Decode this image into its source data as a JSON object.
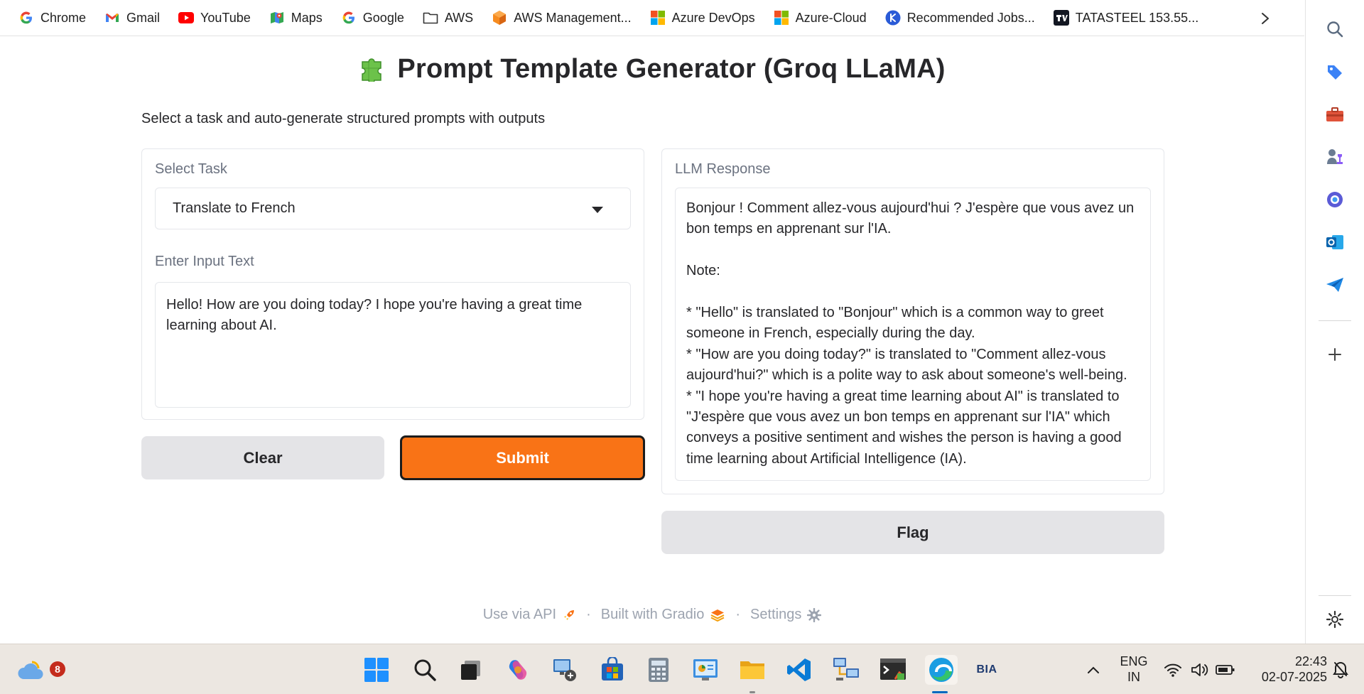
{
  "bookmarks": [
    {
      "label": "Chrome",
      "icon": "google-g-icon"
    },
    {
      "label": "Gmail",
      "icon": "gmail-icon"
    },
    {
      "label": "YouTube",
      "icon": "youtube-icon"
    },
    {
      "label": "Maps",
      "icon": "maps-icon"
    },
    {
      "label": "Google",
      "icon": "google-g-icon"
    },
    {
      "label": "AWS",
      "icon": "folder-icon"
    },
    {
      "label": "AWS Management...",
      "icon": "aws-cube-icon"
    },
    {
      "label": "Azure DevOps",
      "icon": "microsoft-logo-icon"
    },
    {
      "label": "Azure-Cloud",
      "icon": "microsoft-logo-icon"
    },
    {
      "label": "Recommended Jobs...",
      "icon": "naukri-icon"
    },
    {
      "label": "TATASTEEL 153.55...",
      "icon": "tradingview-icon"
    }
  ],
  "app": {
    "title": "Prompt Template Generator (Groq LLaMA)",
    "description": "Select a task and auto-generate structured prompts with outputs",
    "task_label": "Select Task",
    "task_value": "Translate to French",
    "input_label": "Enter Input Text",
    "input_value": "Hello! How are you doing today? I hope you're having a great time learning about AI.",
    "clear_label": "Clear",
    "submit_label": "Submit",
    "response_label": "LLM Response",
    "response_text": "Bonjour ! Comment allez-vous aujourd'hui ? J'espère que vous avez un bon temps en apprenant sur l'IA.\n\nNote:\n\n* \"Hello\" is translated to \"Bonjour\" which is a common way to greet someone in French, especially during the day.\n* \"How are you doing today?\" is translated to \"Comment allez-vous aujourd'hui?\" which is a polite way to ask about someone's well-being.\n* \"I hope you're having a great time learning about AI\" is translated to \"J'espère que vous avez un bon temps en apprenant sur l'IA\" which conveys a positive sentiment and wishes the person is having a good time learning about Artificial Intelligence (IA).",
    "flag_label": "Flag",
    "footer": {
      "api": "Use via API",
      "built": "Built with Gradio",
      "settings": "Settings",
      "separator": "·"
    }
  },
  "taskbar": {
    "weather_badge": "8",
    "lang_line1": "ENG",
    "lang_line2": "IN",
    "time": "22:43",
    "date": "02-07-2025",
    "bia_label": "BIA"
  },
  "colors": {
    "accent": "#f97316",
    "secondary_button": "#e4e4e7",
    "taskbar": "#ece7e1"
  }
}
